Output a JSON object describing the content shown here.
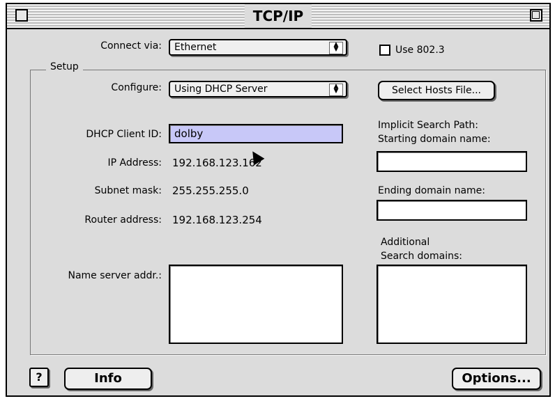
{
  "window": {
    "title": "TCP/IP"
  },
  "connect_via": {
    "label": "Connect via:",
    "value": "Ethernet"
  },
  "use_8023": {
    "label": "Use 802.3",
    "checked": false
  },
  "setup": {
    "group_label": "Setup",
    "configure_label": "Configure:",
    "configure_value": "Using DHCP Server",
    "select_hosts_button": "Select Hosts File...",
    "dhcp_client_id_label": "DHCP Client ID:",
    "dhcp_client_id_value": "dolby",
    "ip_address_label": "IP Address:",
    "ip_address_value": "192.168.123.162",
    "subnet_mask_label": "Subnet mask:",
    "subnet_mask_value": "255.255.255.0",
    "router_address_label": "Router address:",
    "router_address_value": "192.168.123.254",
    "name_server_label": "Name server addr.:",
    "implicit_search_path_label": "Implicit Search Path:",
    "starting_domain_label": "Starting domain name:",
    "ending_domain_label": "Ending domain name:",
    "additional_label_line1": "Additional",
    "additional_label_line2": "Search domains:"
  },
  "footer": {
    "help_icon": "?",
    "info_button": "Info",
    "options_button": "Options..."
  },
  "colors": {
    "window_bg": "#dcdcdc",
    "selection": "#c8c8f8"
  },
  "icons": {
    "popup_arrows": "updown-arrows-icon",
    "help": "question-mark-icon",
    "cursor": "mouse-pointer-icon"
  }
}
